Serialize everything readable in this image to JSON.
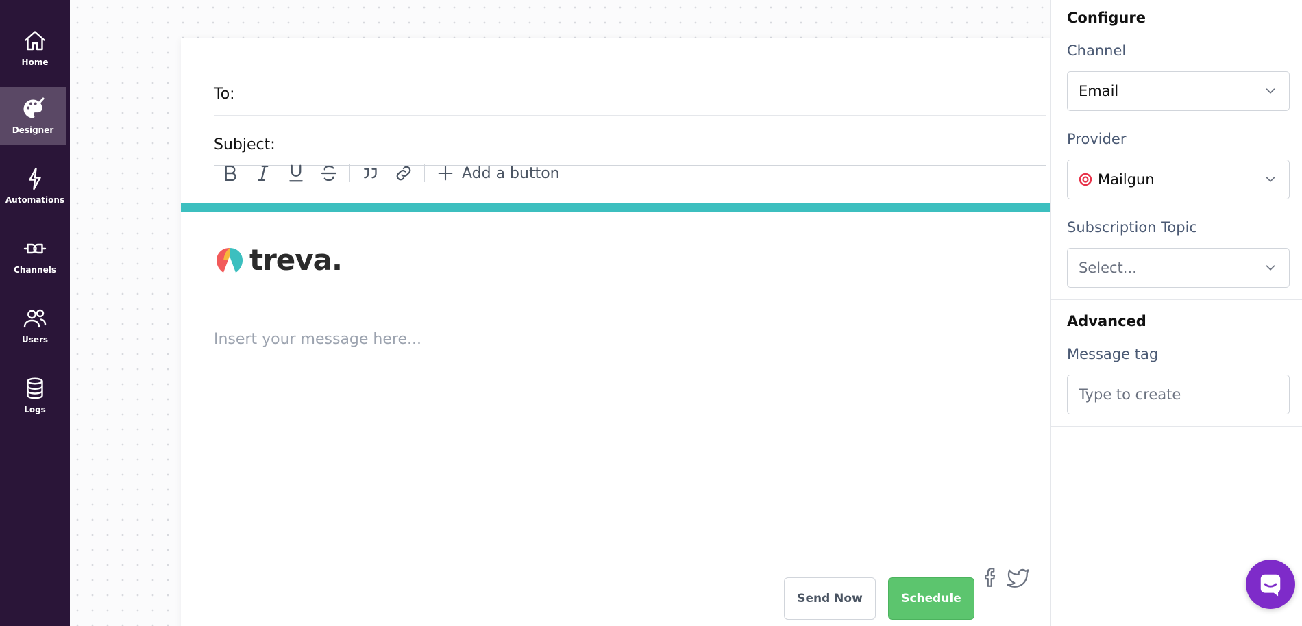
{
  "sidebar": {
    "items": [
      {
        "label": "Home",
        "icon": "home-icon"
      },
      {
        "label": "Designer",
        "icon": "palette-icon",
        "active": true
      },
      {
        "label": "Automations",
        "icon": "lightning-icon"
      },
      {
        "label": "Channels",
        "icon": "channels-icon"
      },
      {
        "label": "Users",
        "icon": "users-icon"
      },
      {
        "label": "Logs",
        "icon": "database-icon"
      }
    ]
  },
  "editor": {
    "to_label": "To:",
    "to_value": "",
    "subject_label": "Subject:",
    "subject_value": "",
    "toolbar": {
      "buttons": [
        "bold-icon",
        "italic-icon",
        "underline-icon",
        "strikethrough-icon",
        "quote-icon",
        "link-icon"
      ],
      "add_button_label": "Add a button"
    },
    "accent_color": "#3cbfbf",
    "logo_text": "treva.",
    "message_placeholder": "Insert your message here...",
    "social_icons": [
      "facebook-icon",
      "twitter-icon"
    ],
    "send_now_label": "Send Now",
    "schedule_label": "Schedule",
    "schedule_color": "#5cc56e"
  },
  "panel": {
    "configure_title": "Configure",
    "channel_label": "Channel",
    "channel_value": "Email",
    "provider_label": "Provider",
    "provider_value": "Mailgun",
    "subscription_label": "Subscription Topic",
    "subscription_placeholder": "Select...",
    "advanced_title": "Advanced",
    "message_tag_label": "Message tag",
    "message_tag_placeholder": "Type to create"
  },
  "chat": {
    "icon": "chat-icon",
    "color": "#7e2bc9"
  }
}
